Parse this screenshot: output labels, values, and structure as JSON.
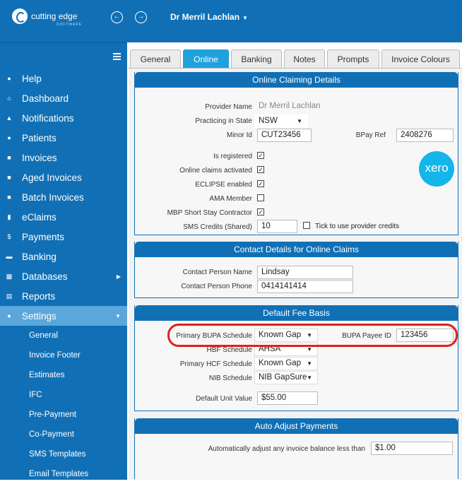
{
  "brand": {
    "name": "cutting edge",
    "sub": "SOFTWARE"
  },
  "header": {
    "user": "Dr Merril Lachlan",
    "back_icon": "arrow-left-icon",
    "forward_icon": "arrow-right-icon"
  },
  "menu": [
    {
      "label": "Help",
      "icon": "info-icon"
    },
    {
      "label": "Dashboard",
      "icon": "home-icon"
    },
    {
      "label": "Notifications",
      "icon": "bell-icon"
    },
    {
      "label": "Patients",
      "icon": "users-icon"
    },
    {
      "label": "Invoices",
      "icon": "user-icon"
    },
    {
      "label": "Aged Invoices",
      "icon": "aged-icon"
    },
    {
      "label": "Batch Invoices",
      "icon": "group-icon"
    },
    {
      "label": "eClaims",
      "icon": "file-icon"
    },
    {
      "label": "Payments",
      "icon": "dollar-icon"
    },
    {
      "label": "Banking",
      "icon": "card-icon"
    },
    {
      "label": "Databases",
      "icon": "database-icon"
    },
    {
      "label": "Reports",
      "icon": "list-icon"
    },
    {
      "label": "Settings",
      "icon": "settings-icon"
    }
  ],
  "settings_sub": [
    "General",
    "Invoice Footer",
    "Estimates",
    "IFC",
    "Pre-Payment",
    "Co-Payment",
    "SMS Templates",
    "Email Templates"
  ],
  "tabs": [
    "General",
    "Online",
    "Banking",
    "Notes",
    "Prompts",
    "Invoice Colours"
  ],
  "online": {
    "title": "Online Claiming Details",
    "provider_name_label": "Provider Name",
    "provider_name": "Dr Merril Lachlan",
    "state_label": "Practicing in State",
    "state": "NSW",
    "minor_id_label": "Minor Id",
    "minor_id": "CUT23456",
    "bpay_label": "BPay Ref",
    "bpay": "2408276",
    "registered_label": "Is registered",
    "claims_label": "Online claims activated",
    "eclipse_label": "ECLIPSE enabled",
    "ama_label": "AMA Member",
    "mbp_label": "MBP Short Stay Contractor",
    "sms_label": "SMS Credits (Shared)",
    "sms": "10",
    "tick_label": "Tick to use provider credits",
    "xero": "xero"
  },
  "contact": {
    "title": "Contact Details for Online Claims",
    "name_label": "Contact Person Name",
    "name": "Lindsay",
    "phone_label": "Contact Person Phone",
    "phone": "0414141414"
  },
  "fee": {
    "title": "Default Fee Basis",
    "bupa_label": "Primary BUPA Schedule",
    "bupa": "Known Gap",
    "bupa_payee_label": "BUPA Payee ID",
    "bupa_payee": "123456",
    "hbf_label": "HBF Schedule",
    "hbf": "AHSA",
    "hcf_label": "Primary HCF Schedule",
    "hcf": "Known Gap",
    "nib_label": "NIB Schedule",
    "nib": "NIB GapSure",
    "unit_label": "Default Unit Value",
    "unit": "$55.00"
  },
  "auto": {
    "title": "Auto Adjust Payments",
    "label": "Automatically adjust any invoice balance less than",
    "value": "$1.00"
  }
}
